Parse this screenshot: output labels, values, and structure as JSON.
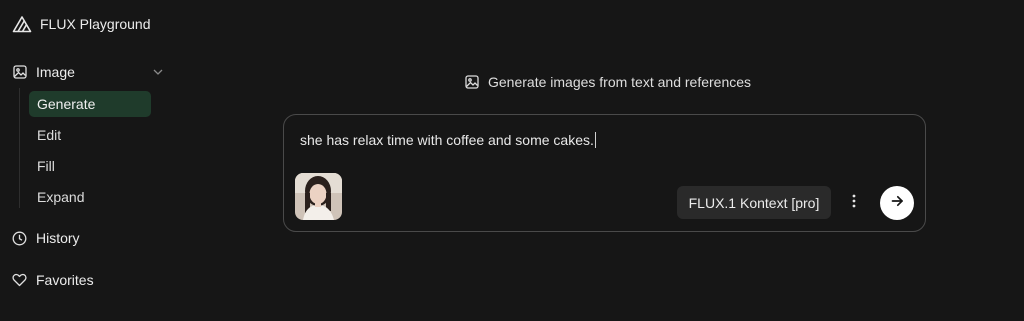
{
  "app": {
    "title": "FLUX Playground",
    "logo_icon": "flux-logo-icon"
  },
  "sidebar": {
    "image_group": {
      "label": "Image",
      "icon": "image-icon",
      "expanded": true,
      "items": [
        {
          "label": "Generate",
          "active": true
        },
        {
          "label": "Edit",
          "active": false
        },
        {
          "label": "Fill",
          "active": false
        },
        {
          "label": "Expand",
          "active": false
        }
      ]
    },
    "history": {
      "label": "History",
      "icon": "clock-icon"
    },
    "favorites": {
      "label": "Favorites",
      "icon": "heart-icon"
    }
  },
  "main": {
    "heading": "Generate images from text and references",
    "heading_icon": "image-icon",
    "composer": {
      "prompt": "she has relax time with coffee and some cakes.",
      "reference_image": "reference-photo-thumbnail",
      "model": "FLUX.1 Kontext [pro]",
      "more_icon": "vertical-dots-icon",
      "send_icon": "arrow-right-icon"
    }
  },
  "colors": {
    "background": "#161616",
    "active_item_bg": "#1f3b2b",
    "model_button_bg": "#2a2a2a",
    "composer_border": "#4a4a4a",
    "send_button_bg": "#ffffff"
  }
}
